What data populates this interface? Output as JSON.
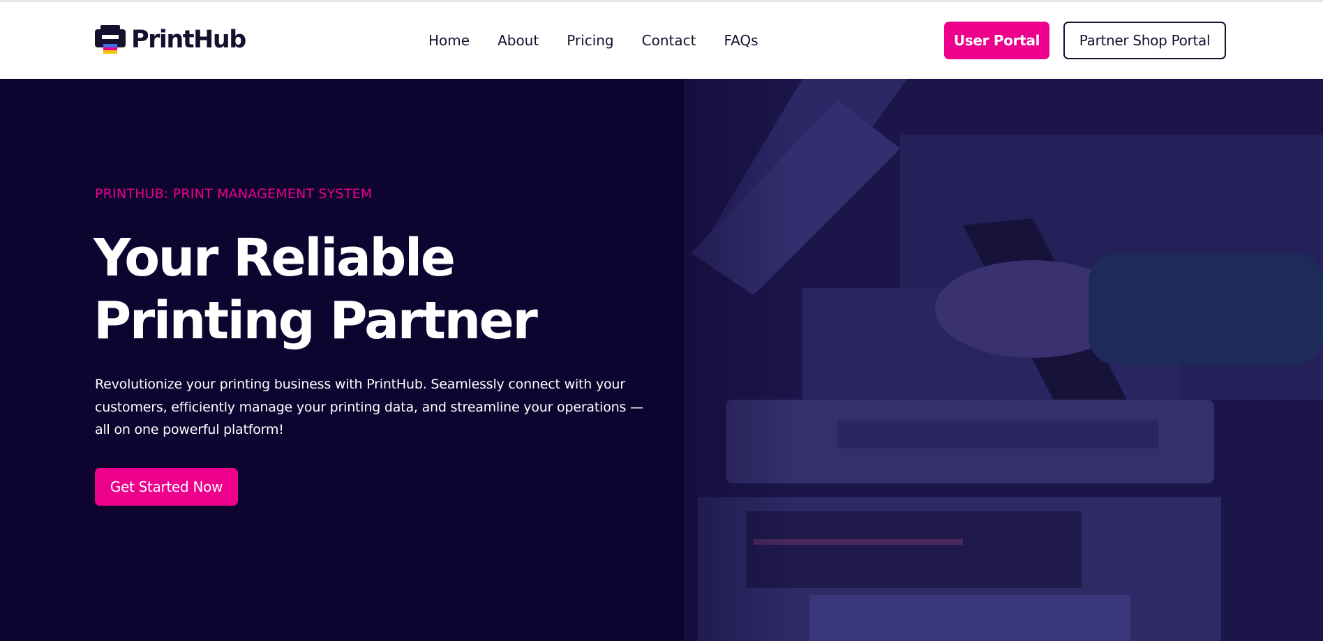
{
  "brand": {
    "name": "PrintHub",
    "logo_icon": "printer-icon",
    "colors": {
      "accent": "#ec008c",
      "dark": "#14102e",
      "hero_bg": "#0d0530"
    }
  },
  "nav": {
    "items": [
      {
        "label": "Home"
      },
      {
        "label": "About"
      },
      {
        "label": "Pricing"
      },
      {
        "label": "Contact"
      },
      {
        "label": "FAQs"
      }
    ]
  },
  "header_actions": {
    "user_portal": "User Portal",
    "partner_portal": "Partner Shop Portal"
  },
  "hero": {
    "eyebrow": "PRINTHUB: PRINT MANAGEMENT SYSTEM",
    "headline_lines": [
      "Your Reliable",
      "Printing Partner"
    ],
    "description_lines": [
      "Revolutionize your printing business with PrintHub. Seamlessly connect with your",
      "customers, efficiently manage your printing data, and streamline your operations —",
      "all on one powerful platform!"
    ],
    "cta": "Get Started Now",
    "background_image": "person-using-printer-photo"
  }
}
